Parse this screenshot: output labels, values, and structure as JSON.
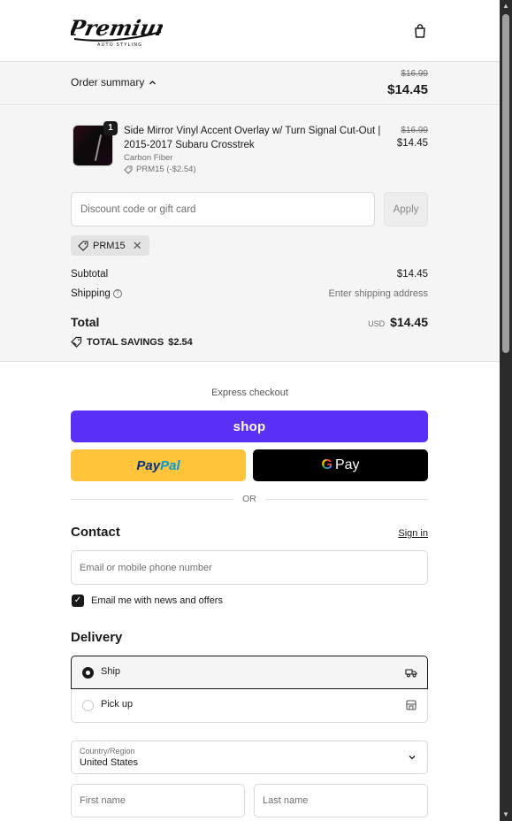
{
  "header": {
    "logo_text": "Premium",
    "logo_subtext": "AUTO STYLING",
    "cart_icon": "shopping-bag-icon"
  },
  "summary": {
    "toggle_label": "Order summary",
    "original_total": "$16.99",
    "total": "$14.45"
  },
  "line_item": {
    "quantity": "1",
    "title": "Side Mirror Vinyl Accent Overlay w/ Turn Signal Cut-Out | 2015-2017 Subaru Crosstrek",
    "variant": "Carbon Fiber",
    "discount": "PRM15 (-$2.54)",
    "original_price": "$16.99",
    "price": "$14.45"
  },
  "discount": {
    "placeholder": "Discount code or gift card",
    "apply_label": "Apply",
    "applied_code": "PRM15"
  },
  "totals": {
    "subtotal_label": "Subtotal",
    "subtotal_value": "$14.45",
    "shipping_label": "Shipping",
    "shipping_value": "Enter shipping address",
    "total_label": "Total",
    "currency": "USD",
    "total_value": "$14.45",
    "savings_label": "TOTAL SAVINGS",
    "savings_value": "$2.54"
  },
  "express": {
    "title": "Express checkout",
    "shop_label": "shop",
    "paypal_part1": "Pay",
    "paypal_part2": "Pal",
    "gpay_label": "Pay",
    "divider": "OR"
  },
  "contact": {
    "title": "Contact",
    "signin": "Sign in",
    "email_placeholder": "Email or mobile phone number",
    "newsletter_label": "Email me with news and offers",
    "newsletter_checked": true
  },
  "delivery": {
    "title": "Delivery",
    "options": [
      {
        "label": "Ship",
        "selected": true,
        "icon": "truck-icon"
      },
      {
        "label": "Pick up",
        "selected": false,
        "icon": "store-icon"
      }
    ],
    "country_label": "Country/Region",
    "country_value": "United States",
    "first_name_placeholder": "First name",
    "last_name_placeholder": "Last name"
  },
  "colors": {
    "shop_pay": "#5a31f4",
    "paypal": "#ffc439",
    "gpay": "#000000",
    "summary_bg": "#f5f5f5"
  }
}
